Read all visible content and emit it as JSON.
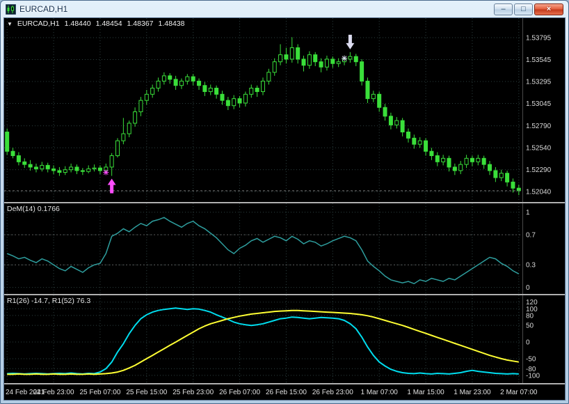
{
  "window": {
    "title": "EURCAD,H1",
    "controls": {
      "minimize": "–",
      "restore": "□",
      "close": "×"
    }
  },
  "colors": {
    "background": "#000000",
    "grid": "#2d4040",
    "scale_text": "#d9d9d9",
    "bid_line": "#777777",
    "candle_outline": "#3ADF3A",
    "candle_bull_fill": "#000000",
    "dem_line": "#2E9E9E",
    "r1_fast_line": "#00DDEE",
    "r1_slow_line": "#FFFF33",
    "buy_signal": "#FF4DFF",
    "sell_signal": "#DCDCF0"
  },
  "main_chart": {
    "collapse_icon": "▼",
    "symbol": "EURCAD,H1",
    "open": "1.48440",
    "high": "1.48454",
    "low": "1.48367",
    "close": "1.48438"
  },
  "indicators": {
    "dem_label": "DeM(14) 0.1766",
    "r1_label": "R1(26) -14.7, R1(52) 76.3"
  },
  "chart_data": [
    {
      "type": "candlestick",
      "title": "EURCAD,H1",
      "timeframe": "H1",
      "label_every": 8,
      "x_labels": [
        "24 Feb 2021",
        "24 Feb 23:00",
        "25 Feb 07:00",
        "25 Feb 15:00",
        "25 Feb 23:00",
        "26 Feb 07:00",
        "26 Feb 15:00",
        "26 Feb 23:00",
        "1 Mar 07:00",
        "1 Mar 15:00",
        "1 Mar 23:00",
        "2 Mar 07:00"
      ],
      "y_ticks": [
        "1.53795",
        "1.53545",
        "1.53295",
        "1.53045",
        "1.52790",
        "1.52540",
        "1.52290",
        "1.52040"
      ],
      "ylim": [
        1.5197,
        1.5397
      ],
      "ohlc": [
        [
          1.5272,
          1.5276,
          1.5246,
          1.525
        ],
        [
          1.525,
          1.5254,
          1.5242,
          1.5245
        ],
        [
          1.5245,
          1.5249,
          1.5234,
          1.5238
        ],
        [
          1.5238,
          1.5242,
          1.5231,
          1.5235
        ],
        [
          1.5235,
          1.524,
          1.5228,
          1.5232
        ],
        [
          1.5232,
          1.5236,
          1.5226,
          1.523
        ],
        [
          1.523,
          1.5238,
          1.5227,
          1.5234
        ],
        [
          1.5234,
          1.5237,
          1.5226,
          1.523
        ],
        [
          1.523,
          1.5234,
          1.5224,
          1.5228
        ],
        [
          1.5228,
          1.5232,
          1.5222,
          1.5226
        ],
        [
          1.5226,
          1.5233,
          1.5223,
          1.5229
        ],
        [
          1.5229,
          1.5236,
          1.5226,
          1.5232
        ],
        [
          1.5232,
          1.5235,
          1.5224,
          1.5228
        ],
        [
          1.5228,
          1.5231,
          1.5223,
          1.5227
        ],
        [
          1.5227,
          1.5234,
          1.5225,
          1.523
        ],
        [
          1.523,
          1.5235,
          1.5227,
          1.5231
        ],
        [
          1.5231,
          1.5234,
          1.5224,
          1.5228
        ],
        [
          1.5228,
          1.5236,
          1.5226,
          1.5232
        ],
        [
          1.5232,
          1.5248,
          1.5222,
          1.5245
        ],
        [
          1.5245,
          1.5265,
          1.5243,
          1.5262
        ],
        [
          1.5262,
          1.5288,
          1.5258,
          1.527
        ],
        [
          1.527,
          1.5285,
          1.5266,
          1.5282
        ],
        [
          1.5282,
          1.53,
          1.5278,
          1.5295
        ],
        [
          1.5295,
          1.5312,
          1.529,
          1.5308
        ],
        [
          1.5308,
          1.532,
          1.5303,
          1.5315
        ],
        [
          1.5315,
          1.5326,
          1.5311,
          1.5322
        ],
        [
          1.5322,
          1.5334,
          1.5318,
          1.533
        ],
        [
          1.533,
          1.534,
          1.5326,
          1.5336
        ],
        [
          1.5336,
          1.5339,
          1.5327,
          1.5332
        ],
        [
          1.5332,
          1.5336,
          1.532,
          1.5325
        ],
        [
          1.5325,
          1.5333,
          1.5321,
          1.533
        ],
        [
          1.533,
          1.5338,
          1.5326,
          1.5335
        ],
        [
          1.5335,
          1.5338,
          1.5325,
          1.533
        ],
        [
          1.533,
          1.5333,
          1.532,
          1.5325
        ],
        [
          1.5325,
          1.5329,
          1.5313,
          1.5318
        ],
        [
          1.5318,
          1.5326,
          1.5314,
          1.5322
        ],
        [
          1.5322,
          1.5325,
          1.531,
          1.5315
        ],
        [
          1.5315,
          1.5319,
          1.5303,
          1.5308
        ],
        [
          1.5308,
          1.5312,
          1.5297,
          1.5302
        ],
        [
          1.5302,
          1.5314,
          1.5298,
          1.531
        ],
        [
          1.531,
          1.5313,
          1.53,
          1.5305
        ],
        [
          1.5305,
          1.5318,
          1.5301,
          1.5315
        ],
        [
          1.5315,
          1.5326,
          1.5311,
          1.5322
        ],
        [
          1.5322,
          1.5325,
          1.5312,
          1.5318
        ],
        [
          1.5318,
          1.5334,
          1.5314,
          1.533
        ],
        [
          1.533,
          1.5344,
          1.5326,
          1.534
        ],
        [
          1.534,
          1.5356,
          1.5336,
          1.5352
        ],
        [
          1.5352,
          1.5372,
          1.5348,
          1.536
        ],
        [
          1.536,
          1.5368,
          1.535,
          1.5355
        ],
        [
          1.5355,
          1.538,
          1.5351,
          1.5368
        ],
        [
          1.5368,
          1.5372,
          1.535,
          1.5355
        ],
        [
          1.5355,
          1.5359,
          1.5341,
          1.5348
        ],
        [
          1.5348,
          1.5364,
          1.5344,
          1.536
        ],
        [
          1.536,
          1.5363,
          1.5347,
          1.5352
        ],
        [
          1.5352,
          1.5356,
          1.534,
          1.5346
        ],
        [
          1.5346,
          1.5359,
          1.5342,
          1.5355
        ],
        [
          1.5355,
          1.5358,
          1.5345,
          1.535
        ],
        [
          1.535,
          1.5356,
          1.5346,
          1.5352
        ],
        [
          1.5352,
          1.5359,
          1.5348,
          1.5355
        ],
        [
          1.5355,
          1.5363,
          1.5351,
          1.5358
        ],
        [
          1.5358,
          1.5361,
          1.5347,
          1.5352
        ],
        [
          1.5352,
          1.5355,
          1.5325,
          1.533
        ],
        [
          1.533,
          1.5334,
          1.5305,
          1.531
        ],
        [
          1.531,
          1.5319,
          1.5306,
          1.5315
        ],
        [
          1.5315,
          1.5318,
          1.5295,
          1.53
        ],
        [
          1.53,
          1.5304,
          1.5285,
          1.529
        ],
        [
          1.529,
          1.5294,
          1.5275,
          1.528
        ],
        [
          1.528,
          1.5289,
          1.5276,
          1.5285
        ],
        [
          1.5285,
          1.5288,
          1.5267,
          1.5272
        ],
        [
          1.5272,
          1.5276,
          1.526,
          1.5265
        ],
        [
          1.5265,
          1.5269,
          1.5253,
          1.5258
        ],
        [
          1.5258,
          1.5266,
          1.5254,
          1.5262
        ],
        [
          1.5262,
          1.5265,
          1.5245,
          1.525
        ],
        [
          1.525,
          1.5254,
          1.524,
          1.5245
        ],
        [
          1.5245,
          1.5249,
          1.5233,
          1.5238
        ],
        [
          1.5238,
          1.5246,
          1.5234,
          1.5242
        ],
        [
          1.5242,
          1.5245,
          1.5227,
          1.5232
        ],
        [
          1.5232,
          1.5236,
          1.5223,
          1.5228
        ],
        [
          1.5228,
          1.5239,
          1.5224,
          1.5235
        ],
        [
          1.5235,
          1.5246,
          1.5231,
          1.5242
        ],
        [
          1.5242,
          1.5245,
          1.5233,
          1.5238
        ],
        [
          1.5238,
          1.5246,
          1.5234,
          1.5242
        ],
        [
          1.5242,
          1.5245,
          1.523,
          1.5235
        ],
        [
          1.5235,
          1.5239,
          1.5223,
          1.5228
        ],
        [
          1.5228,
          1.5232,
          1.5215,
          1.522
        ],
        [
          1.522,
          1.5229,
          1.5216,
          1.5225
        ],
        [
          1.5225,
          1.5228,
          1.521,
          1.5215
        ],
        [
          1.5215,
          1.5219,
          1.5203,
          1.5208
        ],
        [
          1.5208,
          1.5212,
          1.52,
          1.5205
        ]
      ],
      "signals": [
        {
          "type": "buy",
          "index": 18,
          "price": 1.5222,
          "star_index": 17,
          "star_price": 1.5226,
          "color": "#FF4DFF"
        },
        {
          "type": "sell",
          "index": 59,
          "price": 1.5363,
          "star_index": 58,
          "star_price": 1.5356,
          "color": "#DCDCF0"
        }
      ]
    },
    {
      "type": "line",
      "name": "DeM(14)",
      "last_value": 0.1766,
      "y_ticks": [
        "1",
        "0.7",
        "0.3",
        "0"
      ],
      "levels": [
        0.7,
        0.3
      ],
      "ylim": [
        -0.05,
        1.08
      ],
      "color": "#2E9E9E",
      "values": [
        0.45,
        0.42,
        0.38,
        0.4,
        0.36,
        0.33,
        0.38,
        0.35,
        0.3,
        0.25,
        0.22,
        0.28,
        0.24,
        0.2,
        0.26,
        0.3,
        0.32,
        0.45,
        0.68,
        0.72,
        0.78,
        0.74,
        0.8,
        0.85,
        0.82,
        0.88,
        0.9,
        0.93,
        0.88,
        0.84,
        0.8,
        0.85,
        0.88,
        0.82,
        0.78,
        0.72,
        0.66,
        0.58,
        0.5,
        0.45,
        0.52,
        0.56,
        0.62,
        0.65,
        0.6,
        0.64,
        0.68,
        0.66,
        0.62,
        0.68,
        0.64,
        0.58,
        0.62,
        0.6,
        0.55,
        0.58,
        0.62,
        0.65,
        0.68,
        0.66,
        0.62,
        0.5,
        0.35,
        0.28,
        0.22,
        0.15,
        0.1,
        0.08,
        0.06,
        0.08,
        0.05,
        0.1,
        0.08,
        0.12,
        0.1,
        0.08,
        0.12,
        0.1,
        0.15,
        0.2,
        0.25,
        0.3,
        0.35,
        0.4,
        0.38,
        0.32,
        0.28,
        0.22,
        0.18
      ]
    },
    {
      "type": "line",
      "name": "R1",
      "y_ticks": [
        "120",
        "100",
        "80",
        "50",
        "0",
        "-50",
        "-80",
        "-100"
      ],
      "ylim": [
        -115,
        132
      ],
      "series": [
        {
          "name": "R1(26)",
          "last_value": -14.7,
          "color": "#00DDEE",
          "values": [
            -95,
            -94,
            -95,
            -96,
            -95,
            -94,
            -95,
            -96,
            -95,
            -94,
            -95,
            -93,
            -95,
            -96,
            -94,
            -95,
            -90,
            -80,
            -60,
            -30,
            -5,
            25,
            50,
            70,
            82,
            90,
            95,
            98,
            100,
            102,
            100,
            98,
            100,
            99,
            95,
            90,
            82,
            75,
            68,
            60,
            55,
            52,
            50,
            52,
            55,
            60,
            65,
            70,
            72,
            75,
            74,
            72,
            70,
            72,
            74,
            73,
            72,
            70,
            65,
            55,
            40,
            15,
            -15,
            -40,
            -60,
            -72,
            -82,
            -88,
            -92,
            -94,
            -95,
            -93,
            -95,
            -96,
            -94,
            -95,
            -96,
            -94,
            -92,
            -88,
            -85,
            -88,
            -90,
            -92,
            -94,
            -95,
            -96,
            -95,
            -96
          ]
        },
        {
          "name": "R1(52)",
          "last_value": 76.3,
          "color": "#FFFF33",
          "values": [
            -97,
            -97,
            -96,
            -97,
            -97,
            -96,
            -97,
            -97,
            -96,
            -97,
            -97,
            -96,
            -97,
            -97,
            -96,
            -97,
            -96,
            -95,
            -93,
            -90,
            -85,
            -78,
            -70,
            -60,
            -50,
            -40,
            -30,
            -20,
            -10,
            0,
            10,
            20,
            30,
            40,
            48,
            55,
            60,
            65,
            70,
            74,
            78,
            81,
            84,
            86,
            88,
            90,
            92,
            93,
            94,
            95,
            95,
            94,
            93,
            92,
            91,
            90,
            89,
            88,
            87,
            86,
            84,
            82,
            79,
            75,
            70,
            65,
            60,
            55,
            50,
            44,
            38,
            32,
            26,
            20,
            14,
            8,
            2,
            -4,
            -10,
            -16,
            -22,
            -28,
            -34,
            -40,
            -45,
            -50,
            -54,
            -57,
            -60
          ]
        }
      ]
    }
  ]
}
